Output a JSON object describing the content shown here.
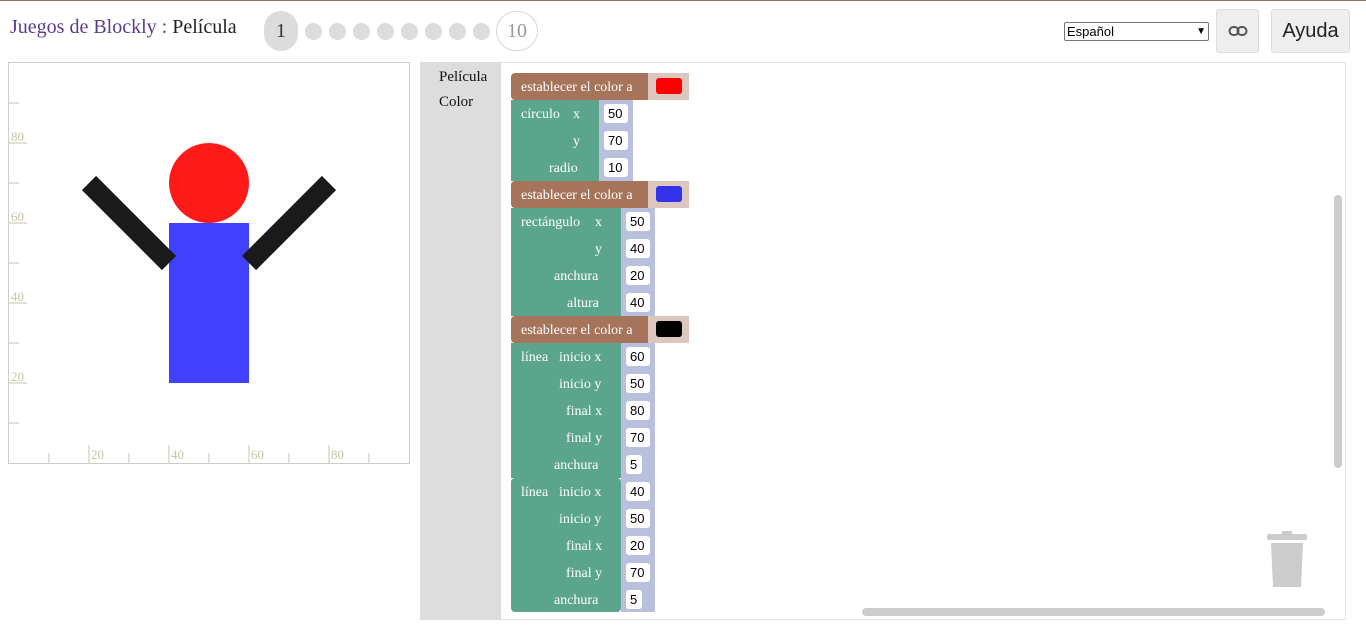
{
  "header": {
    "title_link": "Juegos de Blockly",
    "title_sep": " : ",
    "title_name": "Película",
    "current_level": "1",
    "last_level": "10",
    "language": "Español",
    "help_label": "Ayuda",
    "link_icon": "link-icon"
  },
  "canvas": {
    "y_labels": [
      "80",
      "60",
      "40",
      "20"
    ],
    "x_labels": [
      "20",
      "40",
      "60",
      "80"
    ],
    "colors": {
      "circle": "#ff1a1a",
      "rect": "#4040ff",
      "lines": "#1a1a1a",
      "grid": "#c9c4a8"
    }
  },
  "toolbox": {
    "categories": [
      "Película",
      "Color"
    ]
  },
  "blocks": {
    "set_color_label": "establecer el color a",
    "colors": {
      "first": "#ff0000",
      "second": "#3333ee",
      "third": "#000000"
    },
    "circle": {
      "label": "círculo",
      "x_label": "x",
      "y_label": "y",
      "r_label": "radio",
      "x": "50",
      "y": "70",
      "r": "10"
    },
    "rect": {
      "label": "rectángulo",
      "x_label": "x",
      "y_label": "y",
      "w_label": "anchura",
      "h_label": "altura",
      "x": "50",
      "y": "40",
      "w": "20",
      "h": "40"
    },
    "line1": {
      "label": "línea",
      "x1_label": "inicio x",
      "y1_label": "inicio y",
      "x2_label": "final x",
      "y2_label": "final y",
      "w_label": "anchura",
      "x1": "60",
      "y1": "50",
      "x2": "80",
      "y2": "70",
      "w": "5"
    },
    "line2": {
      "label": "línea",
      "x1_label": "inicio x",
      "y1_label": "inicio y",
      "x2_label": "final x",
      "y2_label": "final y",
      "w_label": "anchura",
      "x1": "40",
      "y1": "50",
      "x2": "20",
      "y2": "70",
      "w": "5"
    }
  }
}
